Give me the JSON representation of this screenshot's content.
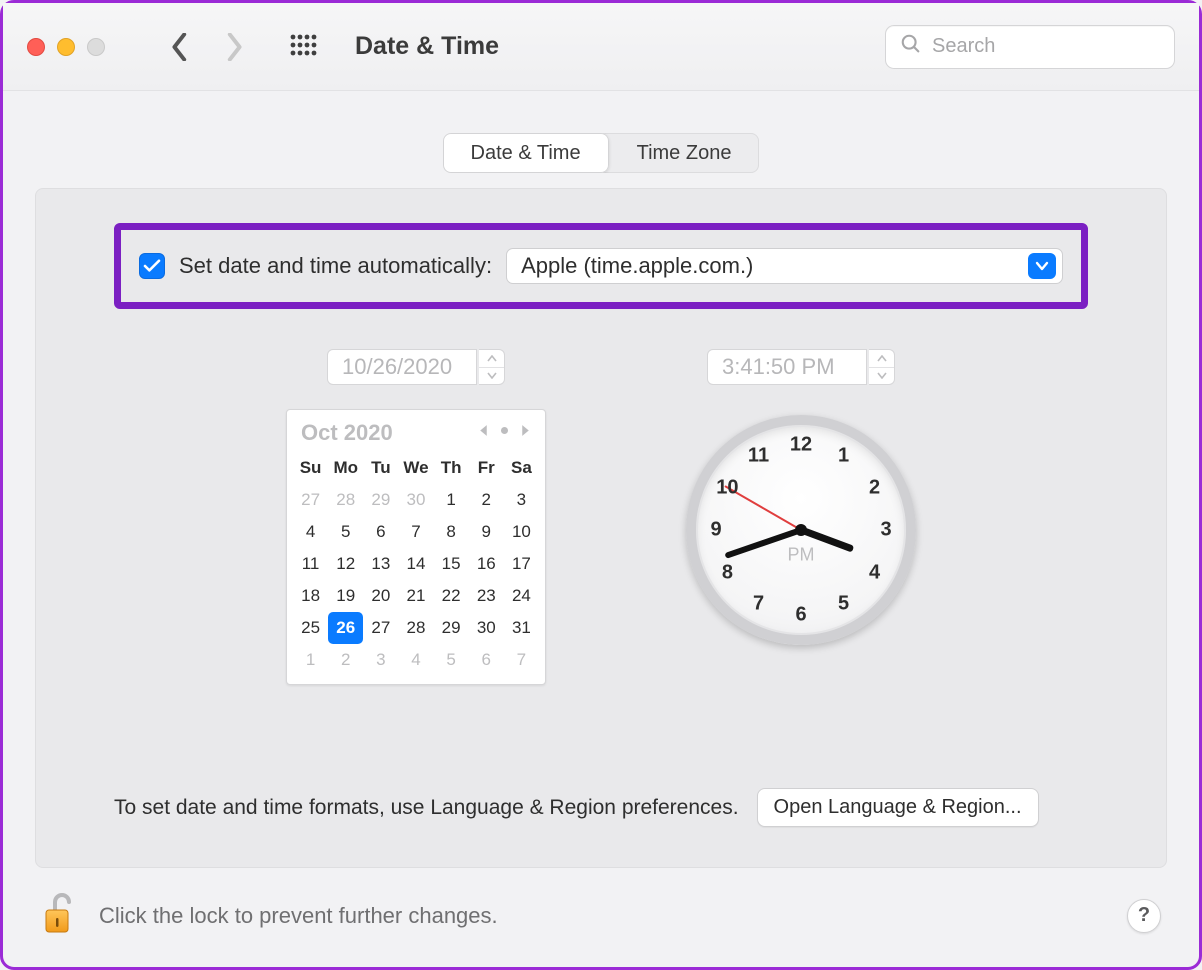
{
  "window": {
    "title": "Date & Time",
    "search_placeholder": "Search"
  },
  "tabs": [
    {
      "label": "Date & Time",
      "active": true
    },
    {
      "label": "Time Zone",
      "active": false
    }
  ],
  "auto": {
    "checked": true,
    "label": "Set date and time automatically:",
    "server": "Apple (time.apple.com.)"
  },
  "date_field": "10/26/2020",
  "time_field": "3:41:50 PM",
  "calendar": {
    "month_label": "Oct 2020",
    "weekdays": [
      "Su",
      "Mo",
      "Tu",
      "We",
      "Th",
      "Fr",
      "Sa"
    ],
    "leading_prev": [
      27,
      28,
      29,
      30
    ],
    "days": [
      1,
      2,
      3,
      4,
      5,
      6,
      7,
      8,
      9,
      10,
      11,
      12,
      13,
      14,
      15,
      16,
      17,
      18,
      19,
      20,
      21,
      22,
      23,
      24,
      25,
      26,
      27,
      28,
      29,
      30,
      31
    ],
    "trailing_next": [
      1,
      2,
      3,
      4,
      5,
      6,
      7
    ],
    "selected_day": 26
  },
  "clock": {
    "ampm": "PM",
    "hour": 3,
    "minute": 41,
    "second": 50,
    "numbers": [
      "12",
      "1",
      "2",
      "3",
      "4",
      "5",
      "6",
      "7",
      "8",
      "9",
      "10",
      "11"
    ]
  },
  "hint_row": {
    "text": "To set date and time formats, use Language & Region preferences.",
    "button": "Open Language & Region..."
  },
  "lock_row": {
    "text": "Click the lock to prevent further changes.",
    "help": "?"
  }
}
